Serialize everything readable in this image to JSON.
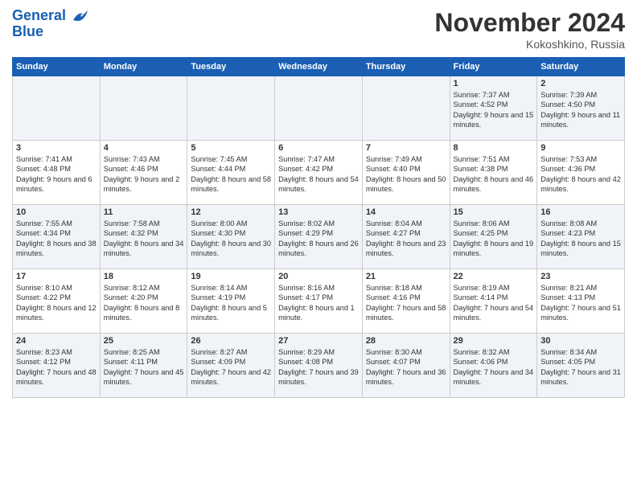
{
  "header": {
    "logo_line1": "General",
    "logo_line2": "Blue",
    "title": "November 2024",
    "location": "Kokoshkino, Russia"
  },
  "days_of_week": [
    "Sunday",
    "Monday",
    "Tuesday",
    "Wednesday",
    "Thursday",
    "Friday",
    "Saturday"
  ],
  "weeks": [
    [
      {
        "day": "",
        "info": ""
      },
      {
        "day": "",
        "info": ""
      },
      {
        "day": "",
        "info": ""
      },
      {
        "day": "",
        "info": ""
      },
      {
        "day": "",
        "info": ""
      },
      {
        "day": "1",
        "info": "Sunrise: 7:37 AM\nSunset: 4:52 PM\nDaylight: 9 hours and 15 minutes."
      },
      {
        "day": "2",
        "info": "Sunrise: 7:39 AM\nSunset: 4:50 PM\nDaylight: 9 hours and 11 minutes."
      }
    ],
    [
      {
        "day": "3",
        "info": "Sunrise: 7:41 AM\nSunset: 4:48 PM\nDaylight: 9 hours and 6 minutes."
      },
      {
        "day": "4",
        "info": "Sunrise: 7:43 AM\nSunset: 4:46 PM\nDaylight: 9 hours and 2 minutes."
      },
      {
        "day": "5",
        "info": "Sunrise: 7:45 AM\nSunset: 4:44 PM\nDaylight: 8 hours and 58 minutes."
      },
      {
        "day": "6",
        "info": "Sunrise: 7:47 AM\nSunset: 4:42 PM\nDaylight: 8 hours and 54 minutes."
      },
      {
        "day": "7",
        "info": "Sunrise: 7:49 AM\nSunset: 4:40 PM\nDaylight: 8 hours and 50 minutes."
      },
      {
        "day": "8",
        "info": "Sunrise: 7:51 AM\nSunset: 4:38 PM\nDaylight: 8 hours and 46 minutes."
      },
      {
        "day": "9",
        "info": "Sunrise: 7:53 AM\nSunset: 4:36 PM\nDaylight: 8 hours and 42 minutes."
      }
    ],
    [
      {
        "day": "10",
        "info": "Sunrise: 7:55 AM\nSunset: 4:34 PM\nDaylight: 8 hours and 38 minutes."
      },
      {
        "day": "11",
        "info": "Sunrise: 7:58 AM\nSunset: 4:32 PM\nDaylight: 8 hours and 34 minutes."
      },
      {
        "day": "12",
        "info": "Sunrise: 8:00 AM\nSunset: 4:30 PM\nDaylight: 8 hours and 30 minutes."
      },
      {
        "day": "13",
        "info": "Sunrise: 8:02 AM\nSunset: 4:29 PM\nDaylight: 8 hours and 26 minutes."
      },
      {
        "day": "14",
        "info": "Sunrise: 8:04 AM\nSunset: 4:27 PM\nDaylight: 8 hours and 23 minutes."
      },
      {
        "day": "15",
        "info": "Sunrise: 8:06 AM\nSunset: 4:25 PM\nDaylight: 8 hours and 19 minutes."
      },
      {
        "day": "16",
        "info": "Sunrise: 8:08 AM\nSunset: 4:23 PM\nDaylight: 8 hours and 15 minutes."
      }
    ],
    [
      {
        "day": "17",
        "info": "Sunrise: 8:10 AM\nSunset: 4:22 PM\nDaylight: 8 hours and 12 minutes."
      },
      {
        "day": "18",
        "info": "Sunrise: 8:12 AM\nSunset: 4:20 PM\nDaylight: 8 hours and 8 minutes."
      },
      {
        "day": "19",
        "info": "Sunrise: 8:14 AM\nSunset: 4:19 PM\nDaylight: 8 hours and 5 minutes."
      },
      {
        "day": "20",
        "info": "Sunrise: 8:16 AM\nSunset: 4:17 PM\nDaylight: 8 hours and 1 minute."
      },
      {
        "day": "21",
        "info": "Sunrise: 8:18 AM\nSunset: 4:16 PM\nDaylight: 7 hours and 58 minutes."
      },
      {
        "day": "22",
        "info": "Sunrise: 8:19 AM\nSunset: 4:14 PM\nDaylight: 7 hours and 54 minutes."
      },
      {
        "day": "23",
        "info": "Sunrise: 8:21 AM\nSunset: 4:13 PM\nDaylight: 7 hours and 51 minutes."
      }
    ],
    [
      {
        "day": "24",
        "info": "Sunrise: 8:23 AM\nSunset: 4:12 PM\nDaylight: 7 hours and 48 minutes."
      },
      {
        "day": "25",
        "info": "Sunrise: 8:25 AM\nSunset: 4:11 PM\nDaylight: 7 hours and 45 minutes."
      },
      {
        "day": "26",
        "info": "Sunrise: 8:27 AM\nSunset: 4:09 PM\nDaylight: 7 hours and 42 minutes."
      },
      {
        "day": "27",
        "info": "Sunrise: 8:29 AM\nSunset: 4:08 PM\nDaylight: 7 hours and 39 minutes."
      },
      {
        "day": "28",
        "info": "Sunrise: 8:30 AM\nSunset: 4:07 PM\nDaylight: 7 hours and 36 minutes."
      },
      {
        "day": "29",
        "info": "Sunrise: 8:32 AM\nSunset: 4:06 PM\nDaylight: 7 hours and 34 minutes."
      },
      {
        "day": "30",
        "info": "Sunrise: 8:34 AM\nSunset: 4:05 PM\nDaylight: 7 hours and 31 minutes."
      }
    ]
  ]
}
